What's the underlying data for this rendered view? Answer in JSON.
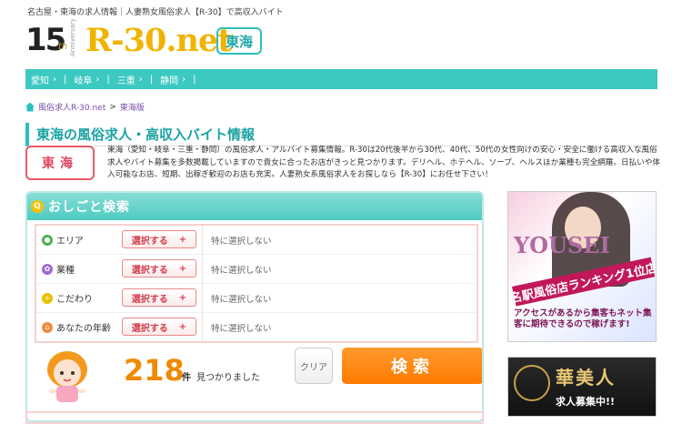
{
  "header": {
    "tagline": "名古屋・東海の求人情報｜人妻熟女風俗求人【R-30】で高収入バイト",
    "logo_15": "15",
    "logo_th": "th",
    "logo_anniversary": "Anniversary",
    "logo_brand": "R-30.net",
    "region_badge": "東海"
  },
  "nav": {
    "items": [
      {
        "label": "愛知"
      },
      {
        "label": "岐阜"
      },
      {
        "label": "三重"
      },
      {
        "label": "静岡"
      }
    ],
    "chevron": "›",
    "separator": "|"
  },
  "breadcrumb": {
    "home_label": "風俗求人R-30.net",
    "separator": ">",
    "current": "東海版"
  },
  "page_title": "東海の風俗求人・高収入バイト情報",
  "region_box": "東海",
  "intro_text": "東海（愛知・岐阜・三重・静岡）の風俗求人・アルバイト募集情報。R-30は20代後半から30代、40代、50代の女性向けの安心・安全に働ける高収入な風俗求人やバイト募集を多数掲載していますので貴女に合ったお店がきっと見つかります。デリヘル、ホテヘル、ソープ、ヘルスほか業種も完全網羅。日払いや体入可能なお店、短期、出稼ぎ歓迎のお店も充実。人妻熟女系風俗求人をお探しなら【R-30】にお任せ下さい！",
  "search": {
    "title": "おしごと検索",
    "icon_glyph": "Q",
    "rows": [
      {
        "label": "エリア",
        "button": "選択する",
        "value": "特に選択しない",
        "icon_color": "#4caf50"
      },
      {
        "label": "業種",
        "button": "選択する",
        "value": "特に選択しない",
        "icon_color": "#9c6ad6"
      },
      {
        "label": "こだわり",
        "button": "選択する",
        "value": "特に選択しない",
        "icon_color": "#e6c200"
      },
      {
        "label": "あなたの年齢",
        "button": "選択する",
        "value": "特に選択しない",
        "icon_color": "#f08a3a"
      }
    ],
    "plus": "+",
    "count": "218",
    "count_unit": "件",
    "count_text": "見つかりました",
    "clear_label": "クリア",
    "submit_label": "検索"
  },
  "ads": {
    "ad1": {
      "brand": "YOUSEI",
      "tag": "名駅風俗店ランキング1位店",
      "copy": "アクセスがあるから集客もネット集客に期待できるので稼げます!"
    },
    "ad2": {
      "title": "華美人",
      "sub": "求人募集中!!"
    }
  },
  "colors": {
    "teal": "#3cc9c2",
    "orange": "#ff7a00",
    "pink_border": "#f7d1d1",
    "red_text": "#d43c4c",
    "gold": "#f0b400"
  }
}
